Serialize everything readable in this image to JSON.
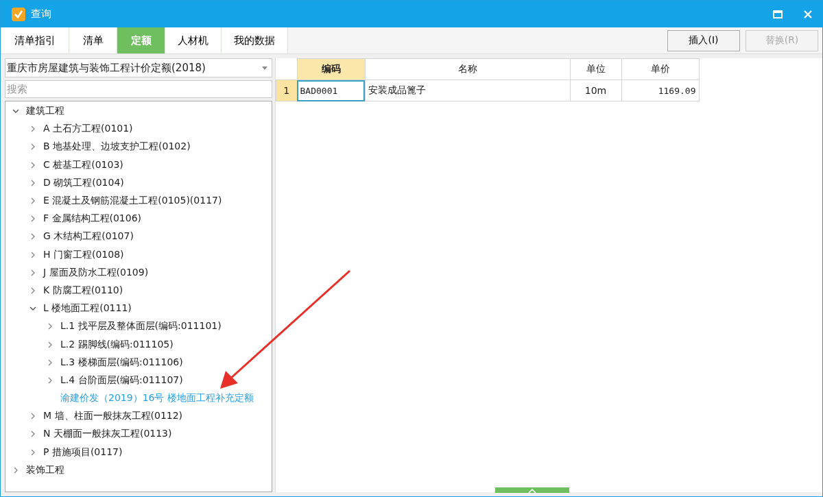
{
  "window": {
    "title": "查询"
  },
  "tabs": [
    {
      "label": "清单指引",
      "selected": false
    },
    {
      "label": "清单",
      "selected": false
    },
    {
      "label": "定额",
      "selected": true
    },
    {
      "label": "人材机",
      "selected": false
    },
    {
      "label": "我的数据",
      "selected": false
    }
  ],
  "buttons": [
    {
      "label": "插入(I)",
      "disabled": false
    },
    {
      "label": "替换(R)",
      "disabled": true
    }
  ],
  "dropdown": {
    "value": "重庆市房屋建筑与装饰工程计价定额(2018)"
  },
  "search": {
    "placeholder": "搜索"
  },
  "tree": [
    {
      "label": "建筑工程",
      "kind": "node",
      "expanded": true,
      "children": [
        {
          "label": "A 土石方工程(0101)",
          "kind": "node",
          "expanded": false
        },
        {
          "label": "B 地基处理、边坡支护工程(0102)",
          "kind": "node",
          "expanded": false
        },
        {
          "label": "C 桩基工程(0103)",
          "kind": "node",
          "expanded": false
        },
        {
          "label": "D 砌筑工程(0104)",
          "kind": "node",
          "expanded": false
        },
        {
          "label": "E 混凝土及钢筋混凝土工程(0105)(0117)",
          "kind": "node",
          "expanded": false
        },
        {
          "label": "F 金属结构工程(0106)",
          "kind": "node",
          "expanded": false
        },
        {
          "label": "G 木结构工程(0107)",
          "kind": "node",
          "expanded": false
        },
        {
          "label": "H 门窗工程(0108)",
          "kind": "node",
          "expanded": false
        },
        {
          "label": "J 屋面及防水工程(0109)",
          "kind": "node",
          "expanded": false
        },
        {
          "label": "K 防腐工程(0110)",
          "kind": "node",
          "expanded": false
        },
        {
          "label": "L 楼地面工程(0111)",
          "kind": "node",
          "expanded": true,
          "children": [
            {
              "label": "L.1 找平层及整体面层(编码:011101)",
              "kind": "node",
              "expanded": false
            },
            {
              "label": "L.2 踢脚线(编码:011105)",
              "kind": "node",
              "expanded": false
            },
            {
              "label": "L.3 楼梯面层(编码:011106)",
              "kind": "node",
              "expanded": false
            },
            {
              "label": "L.4 台阶面层(编码:011107)",
              "kind": "node",
              "expanded": false
            },
            {
              "label": "渝建价发（2019）16号 楼地面工程补充定额",
              "kind": "link"
            }
          ]
        },
        {
          "label": "M 墙、柱面一般抹灰工程(0112)",
          "kind": "node",
          "expanded": false
        },
        {
          "label": "N 天棚面一般抹灰工程(0113)",
          "kind": "node",
          "expanded": false
        },
        {
          "label": "P 措施项目(0117)",
          "kind": "node",
          "expanded": false
        }
      ]
    },
    {
      "label": "装饰工程",
      "kind": "node",
      "expanded": false
    }
  ],
  "table": {
    "columns": [
      "编码",
      "名称",
      "单位",
      "单价"
    ],
    "rows": [
      {
        "index": "1",
        "cells": [
          "BAD0001",
          "安装成品篦子",
          "10m",
          "1169.09"
        ],
        "selected": true
      }
    ]
  }
}
